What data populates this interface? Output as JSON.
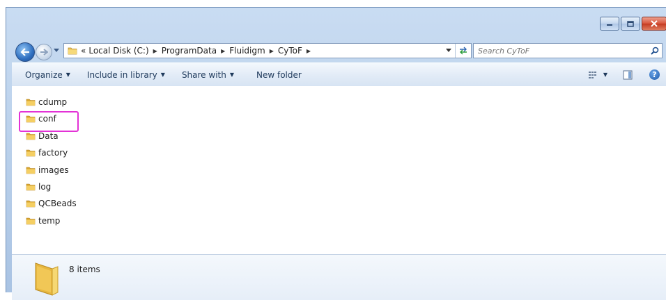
{
  "window": {
    "buttons": {
      "minimize": "minimize",
      "maximize": "maximize",
      "close": "close"
    }
  },
  "address_bar": {
    "overflow": "«",
    "breadcrumbs": [
      "Local Disk (C:)",
      "ProgramData",
      "Fluidigm",
      "CyToF"
    ]
  },
  "search": {
    "placeholder": "Search CyToF"
  },
  "command_bar": {
    "organize": "Organize",
    "include_in_library": "Include in library",
    "share_with": "Share with",
    "new_folder": "New folder"
  },
  "files": [
    "cdump",
    "conf",
    "Data",
    "factory",
    "images",
    "log",
    "QCBeads",
    "temp"
  ],
  "highlighted_item": "conf",
  "highlight_color": "#e332d6",
  "details": {
    "count": "8 items"
  },
  "icons": {
    "folder": "folder-icon",
    "back": "back-arrow-icon",
    "forward": "forward-arrow-icon",
    "refresh": "refresh-icon",
    "search": "search-icon",
    "views": "views-icon",
    "preview": "preview-pane-icon",
    "help": "help-icon"
  }
}
